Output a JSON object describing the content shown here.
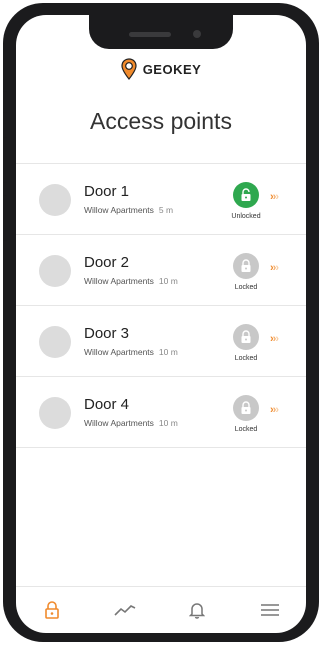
{
  "app": {
    "logo_text": "GEOKEY",
    "title": "Access points"
  },
  "colors": {
    "accent": "#f08a2c",
    "unlocked": "#2fa84f",
    "locked": "#c8c8c8"
  },
  "doors": [
    {
      "name": "Door 1",
      "building": "Willow Apartments",
      "distance": "5 m",
      "status": "Unlocked",
      "icon": "lock-open-icon"
    },
    {
      "name": "Door 2",
      "building": "Willow Apartments",
      "distance": "10 m",
      "status": "Locked",
      "icon": "lock-icon"
    },
    {
      "name": "Door 3",
      "building": "Willow Apartments",
      "distance": "10 m",
      "status": "Locked",
      "icon": "lock-icon"
    },
    {
      "name": "Door 4",
      "building": "Willow Apartments",
      "distance": "10 m",
      "status": "Locked",
      "icon": "lock-icon"
    }
  ],
  "nav": {
    "items": [
      "lock-icon",
      "activity-icon",
      "bell-icon",
      "menu-icon"
    ],
    "active": "lock-icon"
  }
}
